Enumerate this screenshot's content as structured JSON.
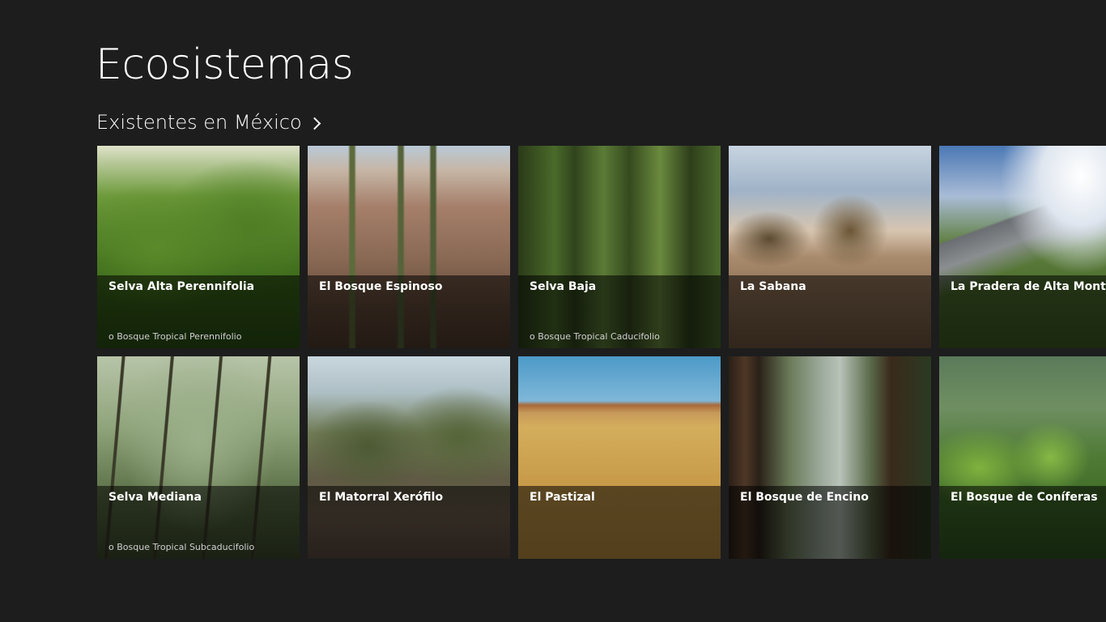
{
  "app": {
    "title": "Ecosistemas"
  },
  "section": {
    "title": "Existentes en México"
  },
  "icons": {
    "section_chevron": "chevron-right-icon"
  },
  "tiles": [
    {
      "name": "Selva Alta Perennifolia",
      "sub": "o Bosque Tropical Perennifolio"
    },
    {
      "name": "El Bosque Espinoso",
      "sub": ""
    },
    {
      "name": "Selva Baja",
      "sub": "o Bosque Tropical Caducifolio"
    },
    {
      "name": "La Sabana",
      "sub": ""
    },
    {
      "name": "La Pradera de Alta Montaña",
      "sub": ""
    },
    {
      "name": "Selva Mediana",
      "sub": "o Bosque Tropical Subcaducifolio"
    },
    {
      "name": "El Matorral Xerófilo",
      "sub": ""
    },
    {
      "name": "El Pastizal",
      "sub": ""
    },
    {
      "name": "El Bosque de Encino",
      "sub": ""
    },
    {
      "name": "El Bosque de Coníferas",
      "sub": ""
    }
  ],
  "colors": {
    "background": "#1d1d1d",
    "text": "#ffffff",
    "caption_overlay": "rgba(0,0,0,0.55)"
  }
}
